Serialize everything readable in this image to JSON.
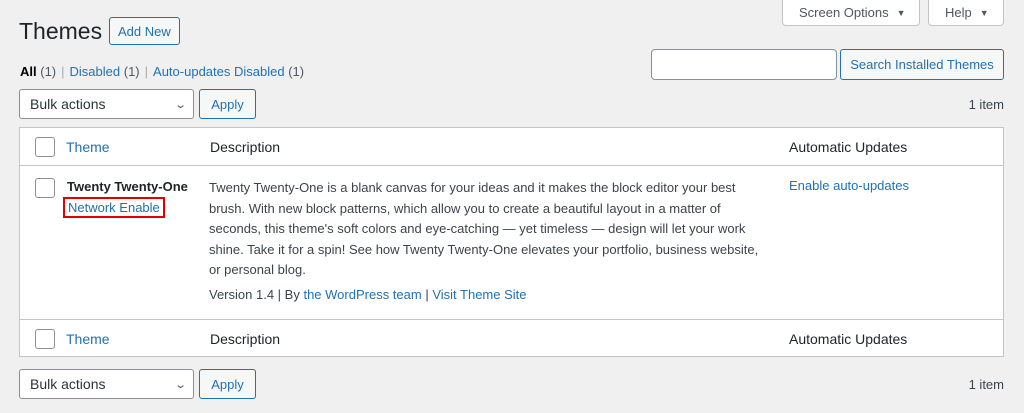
{
  "header": {
    "title": "Themes",
    "add_new": "Add New",
    "screen_options": "Screen Options",
    "help": "Help"
  },
  "filters": [
    {
      "label": "All",
      "count": "(1)"
    },
    {
      "label": "Disabled",
      "count": "(1)"
    },
    {
      "label": "Auto-updates Disabled",
      "count": "(1)"
    }
  ],
  "search": {
    "value": "",
    "button": "Search Installed Themes"
  },
  "bulk": {
    "selected": "Bulk actions",
    "apply": "Apply",
    "items_count": "1 item"
  },
  "table": {
    "columns": {
      "theme": "Theme",
      "description": "Description",
      "auto_updates": "Automatic Updates"
    },
    "rows": [
      {
        "name": "Twenty Twenty-One",
        "action": "Network Enable",
        "description_lines": [
          "Twenty Twenty-One is a blank canvas for your ideas and it makes the block editor your best",
          "brush. With new block patterns, which allow you to create a beautiful layout in a matter of",
          "seconds, this theme's soft colors and eye-catching — yet timeless — design will let your work",
          "shine. Take it for a spin! See how Twenty Twenty-One elevates your portfolio, business website,",
          "or personal blog."
        ],
        "version": "Version 1.4",
        "by": "By",
        "author": "the WordPress team",
        "visit": "Visit Theme Site",
        "auto_update_link": "Enable auto-updates"
      }
    ]
  },
  "colors": {
    "link": "#2271b1",
    "highlight_box": "#e00000",
    "background": "#f0f0f1"
  }
}
